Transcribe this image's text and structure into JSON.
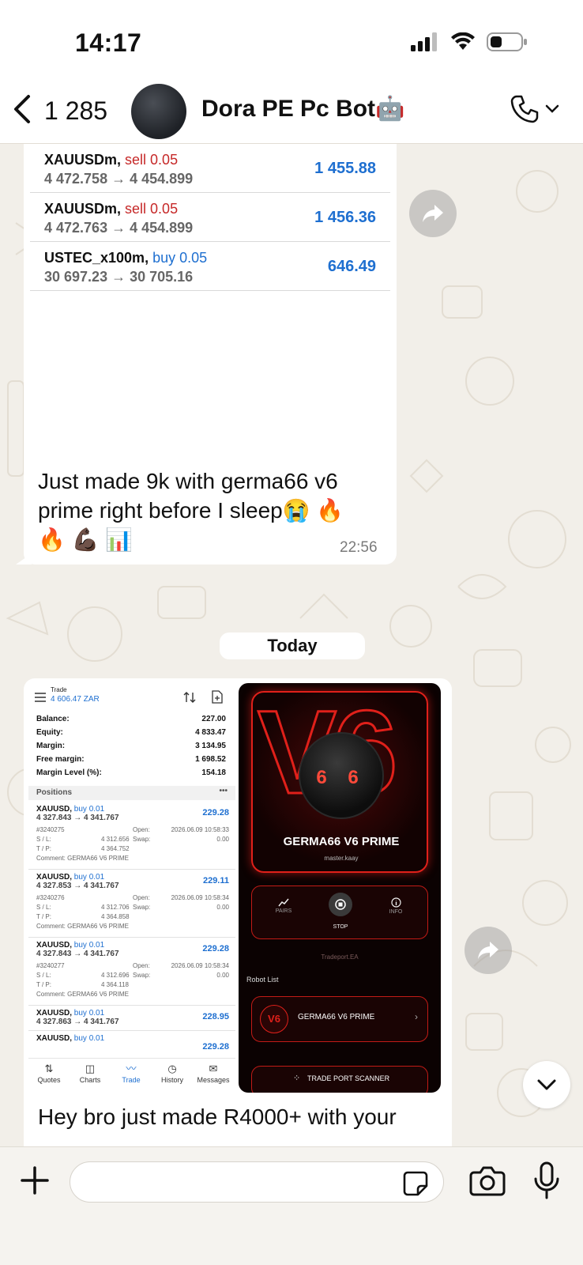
{
  "status_bar": {
    "time": "14:17"
  },
  "header": {
    "back_count": "1 285",
    "contact_name": "Dora PE Pc Bot🤖"
  },
  "trades_top": [
    {
      "symbol": "XAUUSDm,",
      "direction": "sell 0.05",
      "prices": "4 472.758 → 4 454.899",
      "profit": "1 455.88"
    },
    {
      "symbol": "XAUUSDm,",
      "direction": "sell 0.05",
      "prices": "4 472.763 → 4 454.899",
      "profit": "1 456.36"
    },
    {
      "symbol": "USTEC_x100m,",
      "direction": "buy 0.05",
      "prices": "30 697.23 → 30 705.16",
      "profit": "646.49"
    }
  ],
  "message1": {
    "line1": "Just made 9k with germa66 v6",
    "line2": "prime right before I sleep😭 🔥",
    "line3": "🔥 💪🏿 📊",
    "time": "22:56"
  },
  "date_divider": "Today",
  "mt5": {
    "screen_title": "Trade",
    "equity_header": "4 606.47 ZAR",
    "account": [
      {
        "label": "Balance:",
        "value": "227.00"
      },
      {
        "label": "Equity:",
        "value": "4 833.47"
      },
      {
        "label": "Margin:",
        "value": "3 134.95"
      },
      {
        "label": "Free margin:",
        "value": "1 698.52"
      },
      {
        "label": "Margin Level (%):",
        "value": "154.18"
      }
    ],
    "positions_label": "Positions",
    "positions": [
      {
        "symbol": "XAUUSD,",
        "dir": "buy 0.01",
        "prices": "4 327.843 → 4 341.767",
        "profit": "229.28",
        "ticket": "#3240275",
        "open_label": "Open:",
        "open": "2026.06.09 10:58:33",
        "sl_label": "S / L:",
        "sl": "4 312.656",
        "swap_label": "Swap:",
        "swap": "0.00",
        "tp_label": "T / P:",
        "tp": "4 364.752",
        "comment": "Comment:  GERMA66 V6 PRIME"
      },
      {
        "symbol": "XAUUSD,",
        "dir": "buy 0.01",
        "prices": "4 327.853 → 4 341.767",
        "profit": "229.11",
        "ticket": "#3240276",
        "open_label": "Open:",
        "open": "2026.06.09 10:58:34",
        "sl_label": "S / L:",
        "sl": "4 312.706",
        "swap_label": "Swap:",
        "swap": "0.00",
        "tp_label": "T / P:",
        "tp": "4 364.858",
        "comment": "Comment:  GERMA66 V6 PRIME"
      },
      {
        "symbol": "XAUUSD,",
        "dir": "buy 0.01",
        "prices": "4 327.843 → 4 341.767",
        "profit": "229.28",
        "ticket": "#3240277",
        "open_label": "Open:",
        "open": "2026.06.09 10:58:34",
        "sl_label": "S / L:",
        "sl": "4 312.696",
        "swap_label": "Swap:",
        "swap": "0.00",
        "tp_label": "T / P:",
        "tp": "4 364.118",
        "comment": "Comment:  GERMA66 V6 PRIME"
      },
      {
        "symbol": "XAUUSD,",
        "dir": "buy 0.01",
        "prices": "4 327.863 → 4 341.767",
        "profit": "228.95"
      },
      {
        "symbol": "XAUUSD,",
        "dir": "buy 0.01",
        "prices": "",
        "profit": "229.28"
      }
    ],
    "tabs": [
      {
        "label": "Quotes",
        "icon": "⇅"
      },
      {
        "label": "Charts",
        "icon": "◫"
      },
      {
        "label": "Trade",
        "icon": "〰"
      },
      {
        "label": "History",
        "icon": "◷"
      },
      {
        "label": "Messages",
        "icon": "✉"
      }
    ]
  },
  "robot_app": {
    "big_text": "V6",
    "title": "GERMA66 V6 PRIME",
    "author": "master.kaay",
    "eyes": "6 6",
    "controls": [
      {
        "label": "PAIRS",
        "icon": "chart-line-icon"
      },
      {
        "label": "STOP",
        "icon": "stop-icon"
      },
      {
        "label": "INFO",
        "icon": "info-icon"
      }
    ],
    "watermark": "Tradeport.EA",
    "robot_list_label": "Robot List",
    "list_item_badge": "V6",
    "list_item": "GERMA66 V6 PRIME",
    "scanner_label": "TRADE PORT SCANNER"
  },
  "message2": {
    "text": "Hey bro just made R4000+ with your"
  },
  "input": {
    "placeholder": ""
  },
  "colors": {
    "profit_blue": "#1e6fd0",
    "sell_red": "#c62828",
    "chat_bg": "#f2efe9",
    "robot_red": "#e0201a"
  }
}
